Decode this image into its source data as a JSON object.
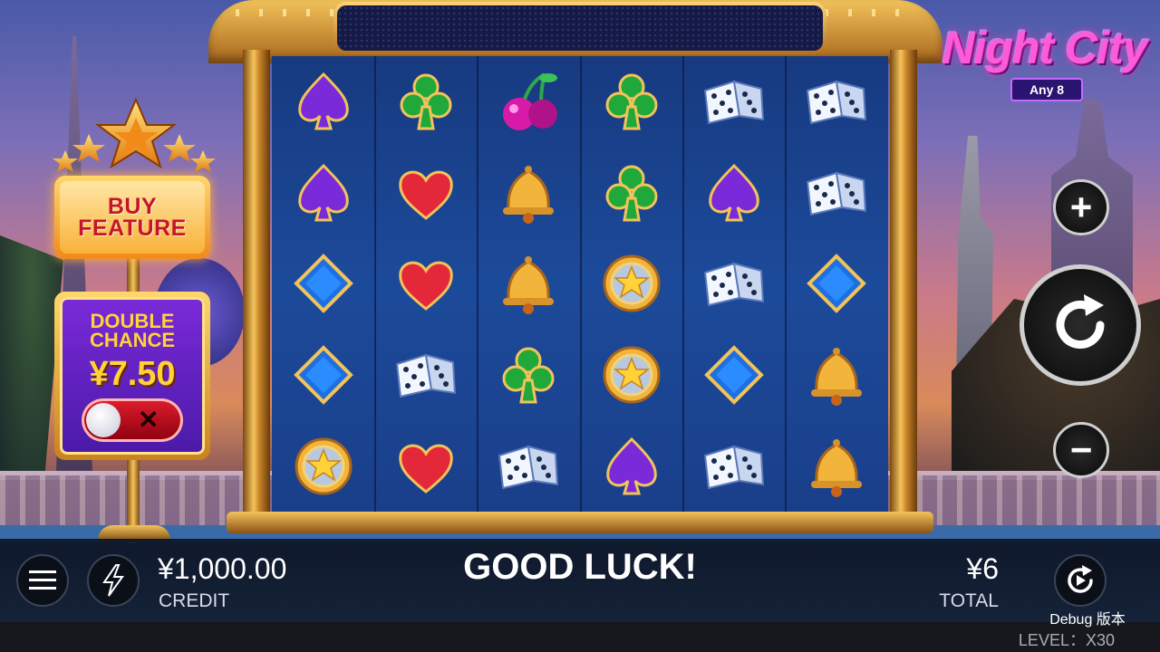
{
  "logo": {
    "title": "Night City",
    "subtitle": "Any 8"
  },
  "buy_feature": {
    "line1": "BUY",
    "line2": "FEATURE"
  },
  "double_chance": {
    "line1": "DOUBLE",
    "line2": "CHANCE",
    "price": "¥7.50",
    "toggle_state": "off",
    "toggle_symbol": "✕"
  },
  "reels": [
    [
      "spade",
      "club",
      "cherry",
      "club",
      "dice",
      "dice"
    ],
    [
      "spade",
      "heart",
      "bell",
      "club",
      "spade",
      "dice"
    ],
    [
      "diamond",
      "heart",
      "bell",
      "star-coin",
      "dice",
      "diamond"
    ],
    [
      "diamond",
      "dice",
      "club",
      "star-coin",
      "diamond",
      "bell"
    ],
    [
      "star-coin",
      "heart",
      "dice",
      "spade",
      "dice",
      "bell"
    ]
  ],
  "colors": {
    "spade": "#7a2ad8",
    "club": "#21a83a",
    "heart": "#e3283a",
    "diamond": "#1e6fe0",
    "gold": "#f2b43a",
    "cherry": "#d81aa8"
  },
  "controls": {
    "plus": "+",
    "minus": "−",
    "spin": "spin-icon"
  },
  "bottom": {
    "credit_value": "¥1,000.00",
    "credit_label": "CREDIT",
    "message": "GOOD LUCK!",
    "total_value": "¥6",
    "total_label": "TOTAL",
    "debug": "Debug 版本",
    "level": "LEVEL：X30"
  }
}
